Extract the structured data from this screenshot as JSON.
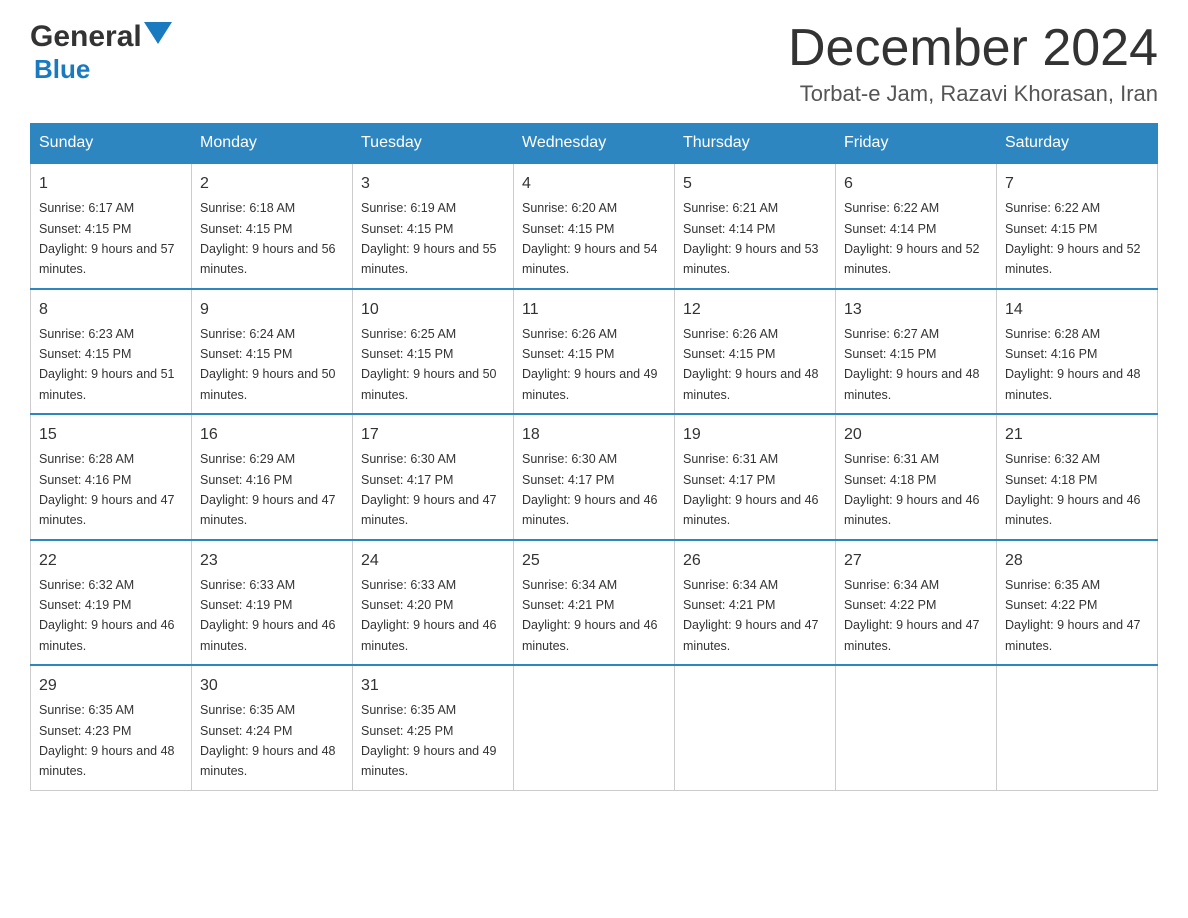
{
  "header": {
    "logo_general": "General",
    "logo_blue": "Blue",
    "month": "December 2024",
    "location": "Torbat-e Jam, Razavi Khorasan, Iran"
  },
  "columns": [
    "Sunday",
    "Monday",
    "Tuesday",
    "Wednesday",
    "Thursday",
    "Friday",
    "Saturday"
  ],
  "weeks": [
    [
      {
        "day": "1",
        "sunrise": "6:17 AM",
        "sunset": "4:15 PM",
        "daylight": "9 hours and 57 minutes."
      },
      {
        "day": "2",
        "sunrise": "6:18 AM",
        "sunset": "4:15 PM",
        "daylight": "9 hours and 56 minutes."
      },
      {
        "day": "3",
        "sunrise": "6:19 AM",
        "sunset": "4:15 PM",
        "daylight": "9 hours and 55 minutes."
      },
      {
        "day": "4",
        "sunrise": "6:20 AM",
        "sunset": "4:15 PM",
        "daylight": "9 hours and 54 minutes."
      },
      {
        "day": "5",
        "sunrise": "6:21 AM",
        "sunset": "4:14 PM",
        "daylight": "9 hours and 53 minutes."
      },
      {
        "day": "6",
        "sunrise": "6:22 AM",
        "sunset": "4:14 PM",
        "daylight": "9 hours and 52 minutes."
      },
      {
        "day": "7",
        "sunrise": "6:22 AM",
        "sunset": "4:15 PM",
        "daylight": "9 hours and 52 minutes."
      }
    ],
    [
      {
        "day": "8",
        "sunrise": "6:23 AM",
        "sunset": "4:15 PM",
        "daylight": "9 hours and 51 minutes."
      },
      {
        "day": "9",
        "sunrise": "6:24 AM",
        "sunset": "4:15 PM",
        "daylight": "9 hours and 50 minutes."
      },
      {
        "day": "10",
        "sunrise": "6:25 AM",
        "sunset": "4:15 PM",
        "daylight": "9 hours and 50 minutes."
      },
      {
        "day": "11",
        "sunrise": "6:26 AM",
        "sunset": "4:15 PM",
        "daylight": "9 hours and 49 minutes."
      },
      {
        "day": "12",
        "sunrise": "6:26 AM",
        "sunset": "4:15 PM",
        "daylight": "9 hours and 48 minutes."
      },
      {
        "day": "13",
        "sunrise": "6:27 AM",
        "sunset": "4:15 PM",
        "daylight": "9 hours and 48 minutes."
      },
      {
        "day": "14",
        "sunrise": "6:28 AM",
        "sunset": "4:16 PM",
        "daylight": "9 hours and 48 minutes."
      }
    ],
    [
      {
        "day": "15",
        "sunrise": "6:28 AM",
        "sunset": "4:16 PM",
        "daylight": "9 hours and 47 minutes."
      },
      {
        "day": "16",
        "sunrise": "6:29 AM",
        "sunset": "4:16 PM",
        "daylight": "9 hours and 47 minutes."
      },
      {
        "day": "17",
        "sunrise": "6:30 AM",
        "sunset": "4:17 PM",
        "daylight": "9 hours and 47 minutes."
      },
      {
        "day": "18",
        "sunrise": "6:30 AM",
        "sunset": "4:17 PM",
        "daylight": "9 hours and 46 minutes."
      },
      {
        "day": "19",
        "sunrise": "6:31 AM",
        "sunset": "4:17 PM",
        "daylight": "9 hours and 46 minutes."
      },
      {
        "day": "20",
        "sunrise": "6:31 AM",
        "sunset": "4:18 PM",
        "daylight": "9 hours and 46 minutes."
      },
      {
        "day": "21",
        "sunrise": "6:32 AM",
        "sunset": "4:18 PM",
        "daylight": "9 hours and 46 minutes."
      }
    ],
    [
      {
        "day": "22",
        "sunrise": "6:32 AM",
        "sunset": "4:19 PM",
        "daylight": "9 hours and 46 minutes."
      },
      {
        "day": "23",
        "sunrise": "6:33 AM",
        "sunset": "4:19 PM",
        "daylight": "9 hours and 46 minutes."
      },
      {
        "day": "24",
        "sunrise": "6:33 AM",
        "sunset": "4:20 PM",
        "daylight": "9 hours and 46 minutes."
      },
      {
        "day": "25",
        "sunrise": "6:34 AM",
        "sunset": "4:21 PM",
        "daylight": "9 hours and 46 minutes."
      },
      {
        "day": "26",
        "sunrise": "6:34 AM",
        "sunset": "4:21 PM",
        "daylight": "9 hours and 47 minutes."
      },
      {
        "day": "27",
        "sunrise": "6:34 AM",
        "sunset": "4:22 PM",
        "daylight": "9 hours and 47 minutes."
      },
      {
        "day": "28",
        "sunrise": "6:35 AM",
        "sunset": "4:22 PM",
        "daylight": "9 hours and 47 minutes."
      }
    ],
    [
      {
        "day": "29",
        "sunrise": "6:35 AM",
        "sunset": "4:23 PM",
        "daylight": "9 hours and 48 minutes."
      },
      {
        "day": "30",
        "sunrise": "6:35 AM",
        "sunset": "4:24 PM",
        "daylight": "9 hours and 48 minutes."
      },
      {
        "day": "31",
        "sunrise": "6:35 AM",
        "sunset": "4:25 PM",
        "daylight": "9 hours and 49 minutes."
      },
      null,
      null,
      null,
      null
    ]
  ]
}
